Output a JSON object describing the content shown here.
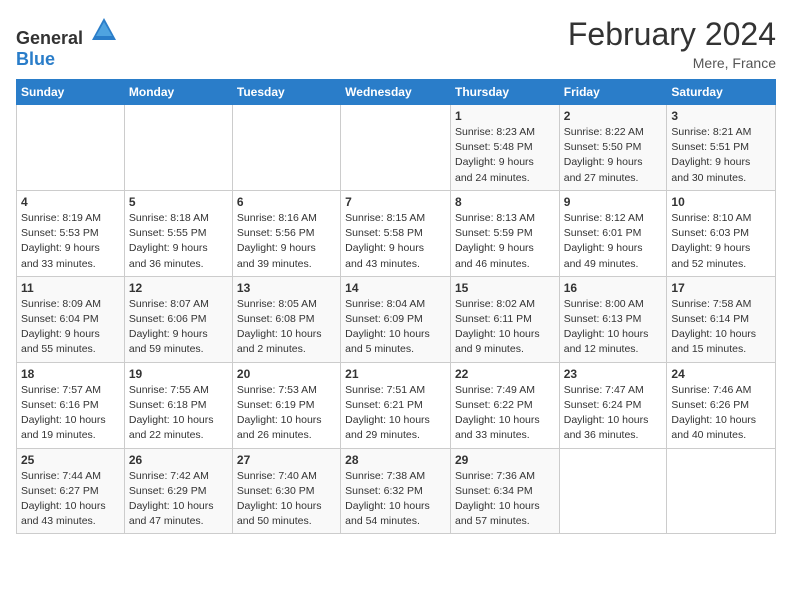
{
  "header": {
    "logo_general": "General",
    "logo_blue": "Blue",
    "title": "February 2024",
    "location": "Mere, France"
  },
  "weekdays": [
    "Sunday",
    "Monday",
    "Tuesday",
    "Wednesday",
    "Thursday",
    "Friday",
    "Saturday"
  ],
  "weeks": [
    [
      {
        "day": "",
        "info": ""
      },
      {
        "day": "",
        "info": ""
      },
      {
        "day": "",
        "info": ""
      },
      {
        "day": "",
        "info": ""
      },
      {
        "day": "1",
        "info": "Sunrise: 8:23 AM\nSunset: 5:48 PM\nDaylight: 9 hours\nand 24 minutes."
      },
      {
        "day": "2",
        "info": "Sunrise: 8:22 AM\nSunset: 5:50 PM\nDaylight: 9 hours\nand 27 minutes."
      },
      {
        "day": "3",
        "info": "Sunrise: 8:21 AM\nSunset: 5:51 PM\nDaylight: 9 hours\nand 30 minutes."
      }
    ],
    [
      {
        "day": "4",
        "info": "Sunrise: 8:19 AM\nSunset: 5:53 PM\nDaylight: 9 hours\nand 33 minutes."
      },
      {
        "day": "5",
        "info": "Sunrise: 8:18 AM\nSunset: 5:55 PM\nDaylight: 9 hours\nand 36 minutes."
      },
      {
        "day": "6",
        "info": "Sunrise: 8:16 AM\nSunset: 5:56 PM\nDaylight: 9 hours\nand 39 minutes."
      },
      {
        "day": "7",
        "info": "Sunrise: 8:15 AM\nSunset: 5:58 PM\nDaylight: 9 hours\nand 43 minutes."
      },
      {
        "day": "8",
        "info": "Sunrise: 8:13 AM\nSunset: 5:59 PM\nDaylight: 9 hours\nand 46 minutes."
      },
      {
        "day": "9",
        "info": "Sunrise: 8:12 AM\nSunset: 6:01 PM\nDaylight: 9 hours\nand 49 minutes."
      },
      {
        "day": "10",
        "info": "Sunrise: 8:10 AM\nSunset: 6:03 PM\nDaylight: 9 hours\nand 52 minutes."
      }
    ],
    [
      {
        "day": "11",
        "info": "Sunrise: 8:09 AM\nSunset: 6:04 PM\nDaylight: 9 hours\nand 55 minutes."
      },
      {
        "day": "12",
        "info": "Sunrise: 8:07 AM\nSunset: 6:06 PM\nDaylight: 9 hours\nand 59 minutes."
      },
      {
        "day": "13",
        "info": "Sunrise: 8:05 AM\nSunset: 6:08 PM\nDaylight: 10 hours\nand 2 minutes."
      },
      {
        "day": "14",
        "info": "Sunrise: 8:04 AM\nSunset: 6:09 PM\nDaylight: 10 hours\nand 5 minutes."
      },
      {
        "day": "15",
        "info": "Sunrise: 8:02 AM\nSunset: 6:11 PM\nDaylight: 10 hours\nand 9 minutes."
      },
      {
        "day": "16",
        "info": "Sunrise: 8:00 AM\nSunset: 6:13 PM\nDaylight: 10 hours\nand 12 minutes."
      },
      {
        "day": "17",
        "info": "Sunrise: 7:58 AM\nSunset: 6:14 PM\nDaylight: 10 hours\nand 15 minutes."
      }
    ],
    [
      {
        "day": "18",
        "info": "Sunrise: 7:57 AM\nSunset: 6:16 PM\nDaylight: 10 hours\nand 19 minutes."
      },
      {
        "day": "19",
        "info": "Sunrise: 7:55 AM\nSunset: 6:18 PM\nDaylight: 10 hours\nand 22 minutes."
      },
      {
        "day": "20",
        "info": "Sunrise: 7:53 AM\nSunset: 6:19 PM\nDaylight: 10 hours\nand 26 minutes."
      },
      {
        "day": "21",
        "info": "Sunrise: 7:51 AM\nSunset: 6:21 PM\nDaylight: 10 hours\nand 29 minutes."
      },
      {
        "day": "22",
        "info": "Sunrise: 7:49 AM\nSunset: 6:22 PM\nDaylight: 10 hours\nand 33 minutes."
      },
      {
        "day": "23",
        "info": "Sunrise: 7:47 AM\nSunset: 6:24 PM\nDaylight: 10 hours\nand 36 minutes."
      },
      {
        "day": "24",
        "info": "Sunrise: 7:46 AM\nSunset: 6:26 PM\nDaylight: 10 hours\nand 40 minutes."
      }
    ],
    [
      {
        "day": "25",
        "info": "Sunrise: 7:44 AM\nSunset: 6:27 PM\nDaylight: 10 hours\nand 43 minutes."
      },
      {
        "day": "26",
        "info": "Sunrise: 7:42 AM\nSunset: 6:29 PM\nDaylight: 10 hours\nand 47 minutes."
      },
      {
        "day": "27",
        "info": "Sunrise: 7:40 AM\nSunset: 6:30 PM\nDaylight: 10 hours\nand 50 minutes."
      },
      {
        "day": "28",
        "info": "Sunrise: 7:38 AM\nSunset: 6:32 PM\nDaylight: 10 hours\nand 54 minutes."
      },
      {
        "day": "29",
        "info": "Sunrise: 7:36 AM\nSunset: 6:34 PM\nDaylight: 10 hours\nand 57 minutes."
      },
      {
        "day": "",
        "info": ""
      },
      {
        "day": "",
        "info": ""
      }
    ]
  ]
}
